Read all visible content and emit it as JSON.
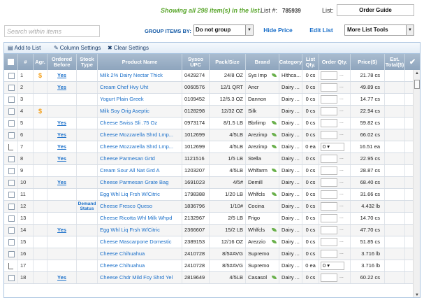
{
  "header": {
    "showing_text": "Showing all 298 item(s) in the list.",
    "list_number_label": "List #:",
    "list_number": "785939",
    "list_label": "List:",
    "list_selected": "Order Guide"
  },
  "controls": {
    "search_placeholder": "Search within items",
    "group_label": "GROUP ITEMS BY:",
    "group_selected": "Do not group",
    "hide_price": "Hide Price",
    "edit_list": "Edit List",
    "more_tools": "More List Tools"
  },
  "toolbar": {
    "add_to_list": "Add to List",
    "column_settings": "Column Settings",
    "clear_settings": "Clear Settings"
  },
  "columns": [
    "#",
    "Agr.",
    "Ordered Before",
    "Stock Type",
    "Product Name",
    "Sysco UPC",
    "Pack/Size",
    "Brand",
    "Category",
    "List Qty.",
    "Order Qty.",
    "Price($)",
    "Est. Total($)"
  ],
  "rows": [
    {
      "n": "1",
      "agr": "$",
      "ob": "Yes",
      "stock": "",
      "name": "Milk 2% Dairy Nectar Thick",
      "upc": "0429274",
      "pack": "24/8 OZ",
      "brand": "Sys Imp",
      "leaf": true,
      "cat": "Hlthca...",
      "lq": "0 cs",
      "oq": "",
      "price": "21.78 cs",
      "child": false
    },
    {
      "n": "2",
      "agr": "",
      "ob": "Yes",
      "stock": "",
      "name": "Cream Chef Hvy Uht",
      "upc": "0060576",
      "pack": "12/1 QRT",
      "brand": "Ancr",
      "leaf": false,
      "cat": "Dairy ...",
      "lq": "0 cs",
      "oq": "",
      "price": "49.89 cs",
      "child": false
    },
    {
      "n": "3",
      "agr": "",
      "ob": "",
      "stock": "",
      "name": "Yogurt Plain Greek",
      "upc": "0109452",
      "pack": "12/5.3 OZ",
      "brand": "Dannon",
      "leaf": false,
      "cat": "Dairy ...",
      "lq": "0 cs",
      "oq": "",
      "price": "14.77 cs",
      "child": false
    },
    {
      "n": "4",
      "agr": "$",
      "ob": "",
      "stock": "",
      "name": "Milk Soy Orig Aseptic",
      "upc": "0128298",
      "pack": "12/32 OZ",
      "brand": "Silk",
      "leaf": false,
      "cat": "Dairy ...",
      "lq": "0 cs",
      "oq": "",
      "price": "22.94 cs",
      "child": false
    },
    {
      "n": "5",
      "agr": "",
      "ob": "Yes",
      "stock": "",
      "name": "Cheese Swiss Sli .75 Oz",
      "upc": "0973174",
      "pack": "8/1.5 LB",
      "brand": "Bbrlimp",
      "leaf": true,
      "cat": "Dairy ...",
      "lq": "0 cs",
      "oq": "",
      "price": "59.82 cs",
      "child": false
    },
    {
      "n": "6",
      "agr": "",
      "ob": "Yes",
      "stock": "",
      "name": "Cheese Mozzarella Shrd Lmp...",
      "upc": "1012699",
      "pack": "4/5LB",
      "brand": "Arezimp",
      "leaf": true,
      "cat": "Dairy ...",
      "lq": "0 cs",
      "oq": "",
      "price": "66.02 cs",
      "child": false
    },
    {
      "n": "7",
      "agr": "",
      "ob": "Yes",
      "stock": "",
      "name": "Cheese Mozzarella Shrd Lmp...",
      "upc": "1012699",
      "pack": "4/5LB",
      "brand": "Arezimp",
      "leaf": true,
      "cat": "Dairy ...",
      "lq": "0 ea",
      "oq": "0",
      "price": "16.51 ea",
      "child": true
    },
    {
      "n": "8",
      "agr": "",
      "ob": "Yes",
      "stock": "",
      "name": "Cheese Parmesan Grtd",
      "upc": "1121516",
      "pack": "1/5 LB",
      "brand": "Stella",
      "leaf": false,
      "cat": "Dairy ...",
      "lq": "0 cs",
      "oq": "",
      "price": "22.95 cs",
      "child": false
    },
    {
      "n": "9",
      "agr": "",
      "ob": "",
      "stock": "",
      "name": "Cream Sour All Nat Grd A",
      "upc": "1203207",
      "pack": "4/5LB",
      "brand": "Whlfarm",
      "leaf": true,
      "cat": "Dairy ...",
      "lq": "0 cs",
      "oq": "",
      "price": "28.87 cs",
      "child": false
    },
    {
      "n": "10",
      "agr": "",
      "ob": "Yes",
      "stock": "",
      "name": "Cheese Parmesan Grate Bag",
      "upc": "1691023",
      "pack": "4/5#",
      "brand": "Demill",
      "leaf": false,
      "cat": "Dairy ...",
      "lq": "0 cs",
      "oq": "",
      "price": "68.40 cs",
      "child": false
    },
    {
      "n": "11",
      "agr": "",
      "ob": "",
      "stock": "",
      "name": "Egg Whl Liq Frsh W/Citric",
      "upc": "1798388",
      "pack": "1/20 LB",
      "brand": "Whlfcls",
      "leaf": true,
      "cat": "Dairy ...",
      "lq": "0 cs",
      "oq": "",
      "price": "31.66 cs",
      "child": false
    },
    {
      "n": "12",
      "agr": "",
      "ob": "",
      "stock": "Demand Status",
      "name": "Cheese Fresco Queso",
      "upc": "1836796",
      "pack": "1/10#",
      "brand": "Cocina",
      "leaf": false,
      "cat": "Dairy ...",
      "lq": "0 cs",
      "oq": "",
      "price": "4.432 lb",
      "child": false
    },
    {
      "n": "13",
      "agr": "",
      "ob": "",
      "stock": "",
      "name": "Cheese Ricotta Whl Milk Whpd",
      "upc": "2132967",
      "pack": "2/5 LB",
      "brand": "Frigo",
      "leaf": false,
      "cat": "Dairy ...",
      "lq": "0 cs",
      "oq": "",
      "price": "14.70 cs",
      "child": false
    },
    {
      "n": "14",
      "agr": "",
      "ob": "Yes",
      "stock": "",
      "name": "Egg Whl Liq Frsh W/Citric",
      "upc": "2366607",
      "pack": "15/2 LB",
      "brand": "Whlfcls",
      "leaf": true,
      "cat": "Dairy ...",
      "lq": "0 cs",
      "oq": "",
      "price": "47.70 cs",
      "child": false
    },
    {
      "n": "15",
      "agr": "",
      "ob": "",
      "stock": "",
      "name": "Cheese Mascarpone Domestic",
      "upc": "2389153",
      "pack": "12/16 OZ",
      "brand": "Arezzio",
      "leaf": true,
      "cat": "Dairy ...",
      "lq": "0 cs",
      "oq": "",
      "price": "51.85 cs",
      "child": false
    },
    {
      "n": "16",
      "agr": "",
      "ob": "",
      "stock": "",
      "name": "Cheese Chihuahua",
      "upc": "2410728",
      "pack": "8/5#AVG",
      "brand": "Supremo",
      "leaf": false,
      "cat": "Dairy ...",
      "lq": "0 cs",
      "oq": "",
      "price": "3.716 lb",
      "child": false
    },
    {
      "n": "17",
      "agr": "",
      "ob": "",
      "stock": "",
      "name": "Cheese Chihuahua",
      "upc": "2410728",
      "pack": "8/5#AVG",
      "brand": "Supremo",
      "leaf": false,
      "cat": "Dairy ...",
      "lq": "0 ea",
      "oq": "0",
      "price": "3.716 lb",
      "child": true
    },
    {
      "n": "18",
      "agr": "",
      "ob": "Yes",
      "stock": "",
      "name": "Cheese Chdr Mild Fcy Shrd Yel",
      "upc": "2819649",
      "pack": "4/5LB",
      "brand": "Casasol",
      "leaf": true,
      "cat": "Dairy ...",
      "lq": "0 cs",
      "oq": "",
      "price": "60.22 cs",
      "child": false
    }
  ]
}
